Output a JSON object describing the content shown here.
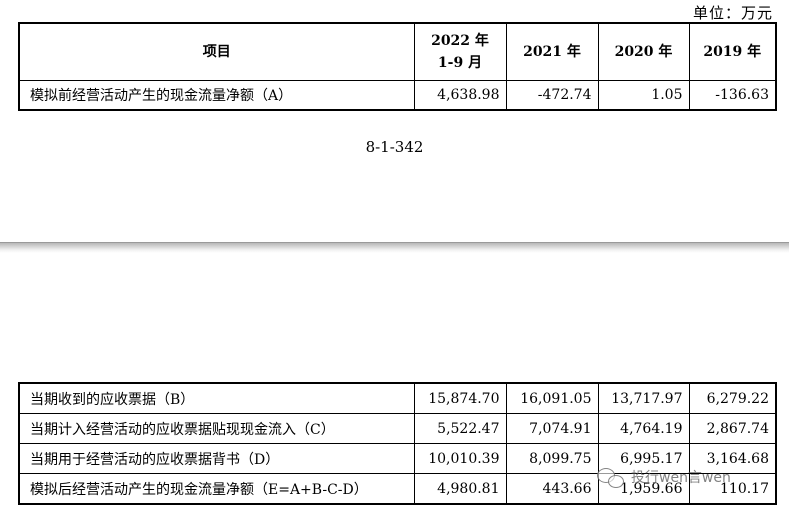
{
  "unit_label": "单位：万元",
  "headers": {
    "item": "项目",
    "p2022_line1": "2022 年",
    "p2022_line2": "1-9 月",
    "p2021": "2021 年",
    "p2020": "2020 年",
    "p2019": "2019 年"
  },
  "top_rows": [
    {
      "label": "模拟前经营活动产生的现金流量净额（A）",
      "v2022": "4,638.98",
      "v2021": "-472.74",
      "v2020": "1.05",
      "v2019": "-136.63"
    }
  ],
  "page_number": "8-1-342",
  "bottom_rows": [
    {
      "label": "当期收到的应收票据（B）",
      "v2022": "15,874.70",
      "v2021": "16,091.05",
      "v2020": "13,717.97",
      "v2019": "6,279.22"
    },
    {
      "label": "当期计入经营活动的应收票据贴现现金流入（C）",
      "v2022": "5,522.47",
      "v2021": "7,074.91",
      "v2020": "4,764.19",
      "v2019": "2,867.74"
    },
    {
      "label": "当期用于经营活动的应收票据背书（D）",
      "v2022": "10,010.39",
      "v2021": "8,099.75",
      "v2020": "6,995.17",
      "v2019": "3,164.68"
    },
    {
      "label": "模拟后经营活动产生的现金流量净额（E=A+B-C-D）",
      "v2022": "4,980.81",
      "v2021": "443.66",
      "v2020": "1,959.66",
      "v2019": "110.17"
    }
  ],
  "watermark": {
    "text": "投行wen言wen",
    "icon": "wechat-icon"
  }
}
